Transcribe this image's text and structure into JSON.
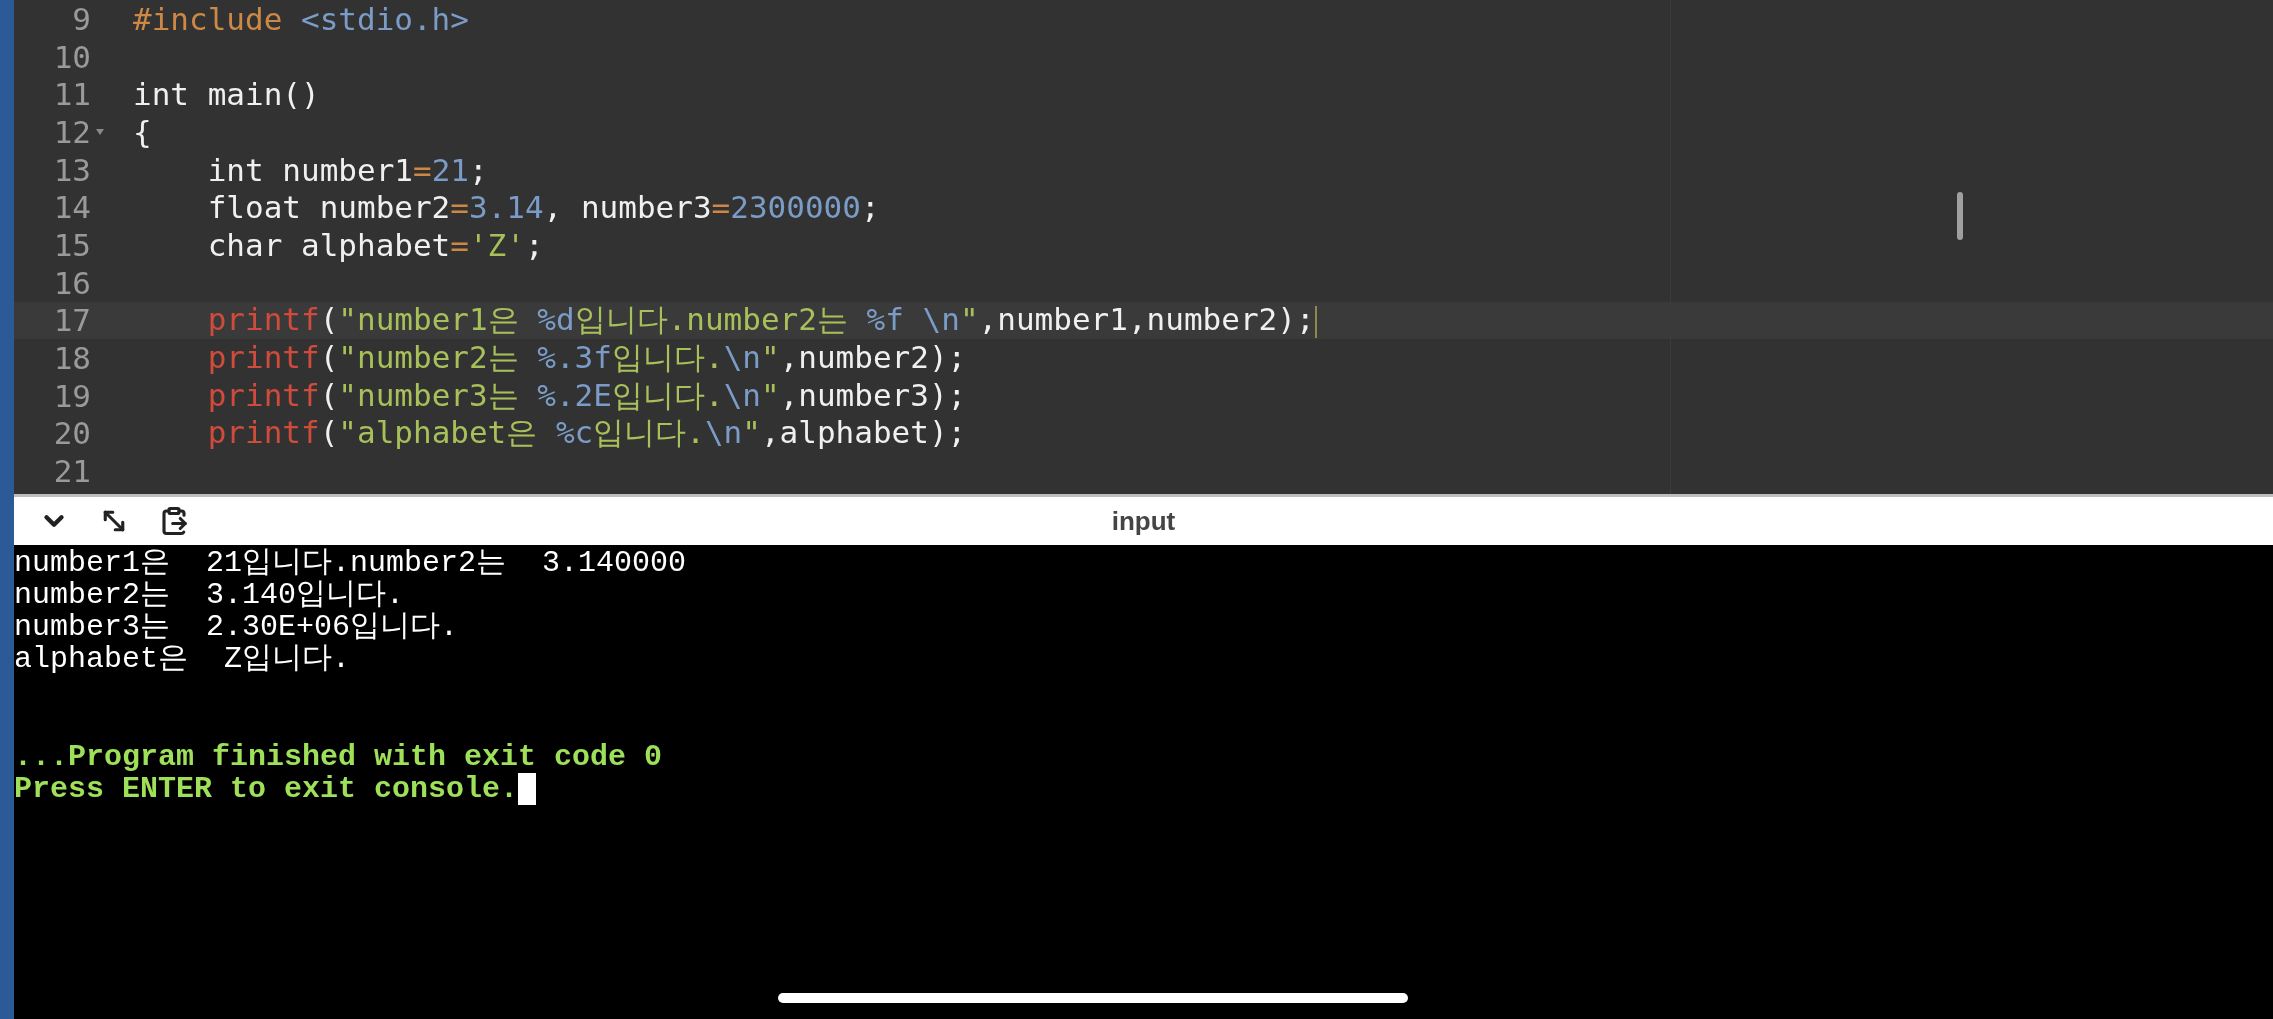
{
  "editor": {
    "lines": [
      {
        "number": "9",
        "tokens": [
          {
            "kind": "directive",
            "text": "#include"
          },
          {
            "kind": "header",
            "text": " <stdio.h>"
          }
        ]
      },
      {
        "number": "10"
      },
      {
        "number": "11",
        "tokens": [
          {
            "kind": "plain",
            "text": "int main()"
          }
        ]
      },
      {
        "number": "12",
        "foldable": true,
        "tokens": [
          {
            "kind": "plain",
            "text": "{"
          }
        ]
      },
      {
        "number": "13",
        "tokens": [
          {
            "kind": "plain",
            "text": "    int number1"
          },
          {
            "kind": "operator",
            "text": "="
          },
          {
            "kind": "number",
            "text": "21"
          },
          {
            "kind": "plain",
            "text": ";"
          }
        ]
      },
      {
        "number": "14",
        "tokens": [
          {
            "kind": "plain",
            "text": "    float number2"
          },
          {
            "kind": "operator",
            "text": "="
          },
          {
            "kind": "number",
            "text": "3.14"
          },
          {
            "kind": "plain",
            "text": ", number3"
          },
          {
            "kind": "operator",
            "text": "="
          },
          {
            "kind": "number",
            "text": "2300000"
          },
          {
            "kind": "plain",
            "text": ";"
          }
        ]
      },
      {
        "number": "15",
        "tokens": [
          {
            "kind": "plain",
            "text": "    char alphabet"
          },
          {
            "kind": "operator",
            "text": "="
          },
          {
            "kind": "string",
            "text": "'Z'"
          },
          {
            "kind": "plain",
            "text": ";"
          }
        ]
      },
      {
        "number": "16"
      },
      {
        "number": "17",
        "active": true,
        "tokens": [
          {
            "kind": "function",
            "text": "    printf"
          },
          {
            "kind": "plain",
            "text": "("
          },
          {
            "kind": "string",
            "text": "\"number1은 "
          },
          {
            "kind": "format",
            "text": "%d"
          },
          {
            "kind": "string",
            "text": "입니다.number2는 "
          },
          {
            "kind": "format",
            "text": "%f \\n"
          },
          {
            "kind": "string",
            "text": "\""
          },
          {
            "kind": "plain",
            "text": ",number1,number2);"
          }
        ]
      },
      {
        "number": "18",
        "tokens": [
          {
            "kind": "function",
            "text": "    printf"
          },
          {
            "kind": "plain",
            "text": "("
          },
          {
            "kind": "string",
            "text": "\"number2는 "
          },
          {
            "kind": "format",
            "text": "%.3f"
          },
          {
            "kind": "string",
            "text": "입니다."
          },
          {
            "kind": "format",
            "text": "\\n"
          },
          {
            "kind": "string",
            "text": "\""
          },
          {
            "kind": "plain",
            "text": ",number2);"
          }
        ]
      },
      {
        "number": "19",
        "tokens": [
          {
            "kind": "function",
            "text": "    printf"
          },
          {
            "kind": "plain",
            "text": "("
          },
          {
            "kind": "string",
            "text": "\"number3는 "
          },
          {
            "kind": "format",
            "text": "%.2E"
          },
          {
            "kind": "string",
            "text": "입니다."
          },
          {
            "kind": "format",
            "text": "\\n"
          },
          {
            "kind": "string",
            "text": "\""
          },
          {
            "kind": "plain",
            "text": ",number3);"
          }
        ]
      },
      {
        "number": "20",
        "tokens": [
          {
            "kind": "function",
            "text": "    printf"
          },
          {
            "kind": "plain",
            "text": "("
          },
          {
            "kind": "string",
            "text": "\"alphabet은 "
          },
          {
            "kind": "format",
            "text": "%c"
          },
          {
            "kind": "string",
            "text": "입니다."
          },
          {
            "kind": "format",
            "text": "\\n"
          },
          {
            "kind": "string",
            "text": "\""
          },
          {
            "kind": "plain",
            "text": ",alphabet);"
          }
        ]
      },
      {
        "number": "21"
      }
    ]
  },
  "console": {
    "title": "input",
    "cursor": true,
    "lines": [
      {
        "kind": "output",
        "text": "number1은  21입니다.number2는  3.140000"
      },
      {
        "kind": "output",
        "text": "number2는  3.140입니다."
      },
      {
        "kind": "output",
        "text": "number3는  2.30E+06입니다."
      },
      {
        "kind": "output",
        "text": "alphabet은  Z입니다."
      },
      {
        "kind": "status",
        "text": "...Program finished with exit code 0"
      },
      {
        "kind": "status",
        "text": "Press ENTER to exit console."
      }
    ]
  }
}
